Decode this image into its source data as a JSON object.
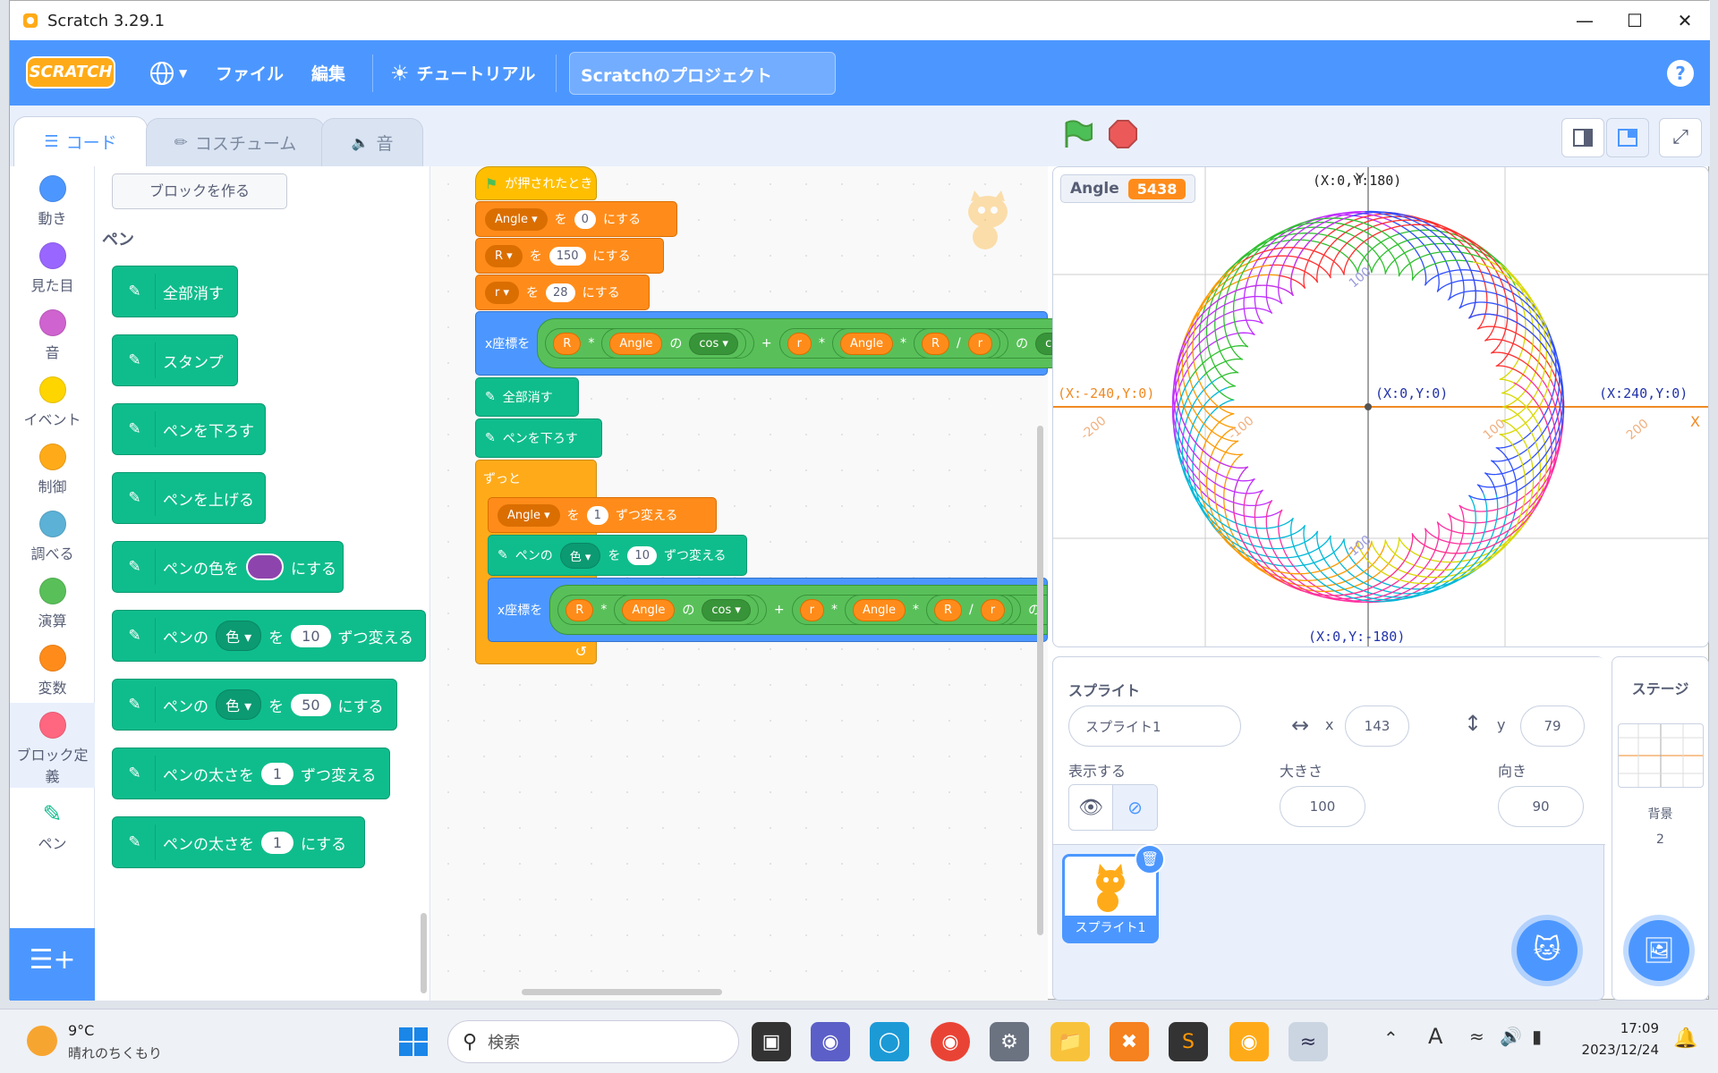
{
  "window": {
    "title": "Scratch 3.29.1"
  },
  "menubar": {
    "logo": "SCRATCH",
    "file": "ファイル",
    "edit": "編集",
    "tutorial": "チュートリアル",
    "project_title": "Scratchのプロジェクト",
    "help": "?"
  },
  "tabs": {
    "code": "コード",
    "costume": "コスチューム",
    "sound": "音"
  },
  "categories": [
    {
      "label": "動き",
      "color": "#4c97ff"
    },
    {
      "label": "見た目",
      "color": "#9966ff"
    },
    {
      "label": "音",
      "color": "#cf63cf"
    },
    {
      "label": "イベント",
      "color": "#ffd500"
    },
    {
      "label": "制御",
      "color": "#ffab19"
    },
    {
      "label": "調べる",
      "color": "#5cb1d6"
    },
    {
      "label": "演算",
      "color": "#59c059"
    },
    {
      "label": "変数",
      "color": "#ff8c1a"
    },
    {
      "label": "ブロック定義",
      "color": "#ff6680"
    },
    {
      "label": "ペン",
      "color": "#0fbd8c"
    }
  ],
  "palette": {
    "make_block": "ブロックを作る",
    "section": "ペン",
    "blocks": {
      "clear": "全部消す",
      "stamp": "スタンプ",
      "pen_down": "ペンを下ろす",
      "pen_up": "ペンを上げる",
      "set_color_a": "ペンの色を",
      "set_color_b": "にする",
      "change_param_a": "ペンの",
      "change_param_dd": "色",
      "change_param_b": "を",
      "change_param_val": "10",
      "change_param_c": "ずつ変える",
      "set_param_a": "ペンの",
      "set_param_dd": "色",
      "set_param_b": "を",
      "set_param_val": "50",
      "set_param_c": "にする",
      "change_size_a": "ペンの太さを",
      "change_size_val": "1",
      "change_size_b": "ずつ変える",
      "set_size_a": "ペンの太さを",
      "set_size_val": "1",
      "set_size_b": "にする"
    },
    "pen_color": "#8e44ad"
  },
  "script": {
    "hat": "が押されたとき",
    "set_angle": {
      "var": "Angle",
      "wo": "を",
      "val": "0",
      "suffix": "にする"
    },
    "set_R": {
      "var": "R",
      "wo": "を",
      "val": "150",
      "suffix": "にする"
    },
    "set_r": {
      "var": "r",
      "wo": "を",
      "val": "28",
      "suffix": "にする"
    },
    "setx": {
      "label": "x座標を",
      "R": "R",
      "mul": "*",
      "angle": "Angle",
      "no": "の",
      "cos": "cos",
      "plus": "+",
      "r": "r",
      "div": "/"
    },
    "clear": "全部消す",
    "pen_down": "ペンを下ろす",
    "forever": "ずっと",
    "change_angle": {
      "var": "Angle",
      "wo": "を",
      "val": "1",
      "suffix": "ずつ変える"
    },
    "change_pen": {
      "a": "ペンの",
      "dd": "色",
      "wo": "を",
      "val": "10",
      "suffix": "ずつ変える"
    },
    "setx2": {
      "label": "x座標を",
      "R": "R",
      "mul": "*",
      "angle": "Angle",
      "no": "の",
      "cos": "cos",
      "plus": "+",
      "r": "r",
      "div": "/"
    }
  },
  "stage": {
    "monitor_label": "Angle",
    "monitor_value": "5438",
    "coords": {
      "top": "(X:0,Y:180)",
      "left": "(X:-240,Y:0)",
      "center": "(X:0,Y:0)",
      "right": "(X:240,Y:0)",
      "bottom": "(X:0,Y:-180)",
      "y_axis": "Y",
      "x_axis": "X"
    },
    "ticks": {
      "t100": "100",
      "tm100": "-100",
      "tm200": "-200",
      "t200": "200"
    }
  },
  "sprite_info": {
    "sprite_label": "スプライト",
    "name": "スプライト1",
    "x_label": "x",
    "x": "143",
    "y_label": "y",
    "y": "79",
    "show_label": "表示する",
    "size_label": "大きさ",
    "size": "100",
    "direction_label": "向き",
    "direction": "90"
  },
  "sprite_list": [
    {
      "name": "スプライト1"
    }
  ],
  "stage_panel": {
    "title": "ステージ",
    "backdrop_label": "背景",
    "backdrop_count": "2"
  },
  "taskbar": {
    "temp": "9°C",
    "weather": "晴れのちくもり",
    "search_placeholder": "検索",
    "time": "17:09",
    "date": "2023/12/24"
  }
}
